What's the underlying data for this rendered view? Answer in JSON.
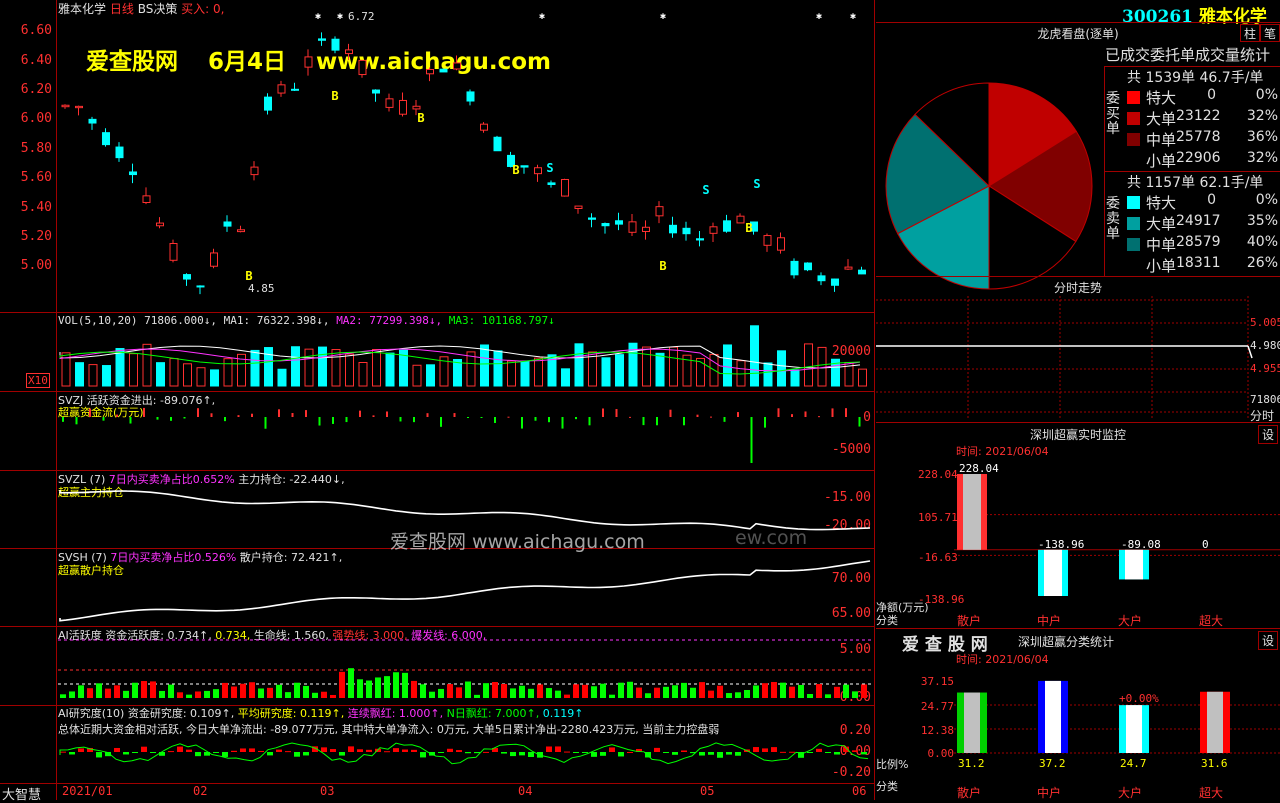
{
  "header": {
    "stock_name": "雅本化学",
    "period": "日线",
    "indicator": "BS决策",
    "buy_text": "买入: 0,",
    "watermark_site": "爱查股网",
    "watermark_date": "6月4日",
    "watermark_url": "www.aichagu.com",
    "high_label": "6.72",
    "low_label": "4.85",
    "b_marker": "B",
    "s_marker": "S"
  },
  "kline_axis": [
    "6.60",
    "6.40",
    "6.20",
    "6.00",
    "5.80",
    "5.60",
    "5.40",
    "5.20",
    "5.00"
  ],
  "vol": {
    "title": "VOL(5,10,20)",
    "vol": "71806.000↓,",
    "ma1": "MA1: 76322.398↓,",
    "ma2": "MA2: 77299.398↓,",
    "ma3": "MA3: 101168.797↓",
    "axis": "20000",
    "unit": "X10"
  },
  "svzj": {
    "title": "SVZJ",
    "line": "活跃资金进出: -89.076↑,",
    "sub": "超赢资金流(万元)",
    "axis0": "0",
    "axis1": "-5000"
  },
  "svzl": {
    "title": "SVZL (7)",
    "ratio": "7日内买卖净占比0.652%",
    "line": "主力持仓: -22.440↓,",
    "sub": "超赢主力持仓",
    "axis0": "-15.00",
    "axis1": "-20.00"
  },
  "svsh": {
    "title": "SVSH (7)",
    "ratio": "7日内买卖净占比0.526%",
    "line": "散户持仓: 72.421↑,",
    "sub": "超赢散户持仓",
    "axis0": "70.00",
    "axis1": "65.00"
  },
  "ai_active": {
    "title": "AI活跃度",
    "a": "资金活跃度: 0.734↑,",
    "b": "0.734,",
    "c": "生命线: 1.560,",
    "d": "强势线: 3.000,",
    "e": "爆发线: 6.000,",
    "axis0": "5.00",
    "axis1": "0.00"
  },
  "ai_research": {
    "title": "AI研究度(10)",
    "a": "资金研究度: 0.109↑,",
    "b": "平均研究度: 0.119↑,",
    "c": "连续飘红: 1.000↑,",
    "d": "N日飘红: 7.000↑,",
    "e": "0.119↑",
    "summary": "总体近期大资金相对活跃, 今日大单净流出: -89.077万元, 其中特大单净流入: 0万元, 大单5日累计净出-2280.423万元, 当前主力控盘弱",
    "axis": [
      "0.20",
      "0.00",
      "-0.20"
    ]
  },
  "bottom_axis": {
    "brand": "大智慧",
    "months": [
      "2021/01",
      "02",
      "03",
      "04",
      "05",
      "06"
    ]
  },
  "center_watermark": "爱查股网      www.aichagu.com",
  "center_watermark_tail": "ew.com",
  "right": {
    "code": "300261",
    "name": "雅本化学",
    "btn_zhu": "柱",
    "btn_bi": "笔",
    "dragon_title": "龙虎看盘(逐单)",
    "stats_title": "已成交委托单成交量统计",
    "buy": {
      "header": "共 1539单 46.7手/单",
      "side_label": "委买单",
      "rows": [
        {
          "label": "特大",
          "count": "0",
          "pct": "0%",
          "color": "#ff0000"
        },
        {
          "label": "大单",
          "count": "23122",
          "pct": "32%",
          "color": "#c00000"
        },
        {
          "label": "中单",
          "count": "25778",
          "pct": "36%",
          "color": "#800000"
        },
        {
          "label": "小单",
          "count": "22906",
          "pct": "32%",
          "color": "#000000"
        }
      ]
    },
    "sell": {
      "header": "共 1157单 62.1手/单",
      "side_label": "委卖单",
      "rows": [
        {
          "label": "特大",
          "count": "0",
          "pct": "0%",
          "color": "#00ffff"
        },
        {
          "label": "大单",
          "count": "24917",
          "pct": "35%",
          "color": "#00a0a0"
        },
        {
          "label": "中单",
          "count": "28579",
          "pct": "40%",
          "color": "#007070"
        },
        {
          "label": "小单",
          "count": "18311",
          "pct": "26%",
          "color": "#000000"
        }
      ]
    },
    "intraday_title": "分时走势",
    "intraday_axis": [
      "5.005",
      "4.980",
      "4.955"
    ],
    "intraday_unit": "分时",
    "intraday_unit_prefix": "71806",
    "monitor": {
      "title": "深圳超赢实时监控",
      "btn": "设",
      "time": "时间: 2021/06/04",
      "axis": [
        "228.04",
        "105.71",
        "-16.63",
        "-138.96"
      ],
      "values": [
        "228.04",
        "-138.96",
        "-89.08",
        "0"
      ],
      "ylabel": "净额(万元)",
      "xlabel": "分类",
      "cats": [
        "散户",
        "中户",
        "大户",
        "超大"
      ]
    },
    "classify": {
      "brand": "爱 查 股 网",
      "title": "深圳超赢分类统计",
      "btn": "设",
      "time": "时间: 2021/06/04",
      "axis": [
        "37.15",
        "24.77",
        "12.38",
        "0.00"
      ],
      "values": [
        "31.2",
        "37.2",
        "24.7",
        "31.6"
      ],
      "top_label": "+0.00%",
      "ylabel": "比例%",
      "xlabel": "分类",
      "cats": [
        "散户",
        "中户",
        "大户",
        "超大"
      ]
    }
  },
  "chart_data": [
    {
      "type": "pie",
      "title": "龙虎看盘(逐单)",
      "categories": [
        "买特大",
        "买大单",
        "买中单",
        "买小单",
        "卖特大",
        "卖大单",
        "卖中单",
        "卖小单"
      ],
      "values": [
        0,
        23122,
        25778,
        22906,
        0,
        24917,
        28579,
        18311
      ]
    },
    {
      "type": "bar",
      "title": "深圳超赢实时监控",
      "categories": [
        "散户",
        "中户",
        "大户",
        "超大"
      ],
      "values": [
        228.04,
        -138.96,
        -89.08,
        0
      ],
      "ylim": [
        -138.96,
        228.04
      ]
    },
    {
      "type": "bar",
      "title": "深圳超赢分类统计",
      "categories": [
        "散户",
        "中户",
        "大户",
        "超大"
      ],
      "values": [
        31.2,
        37.2,
        24.7,
        31.6
      ],
      "ylim": [
        0,
        37.15
      ]
    }
  ]
}
